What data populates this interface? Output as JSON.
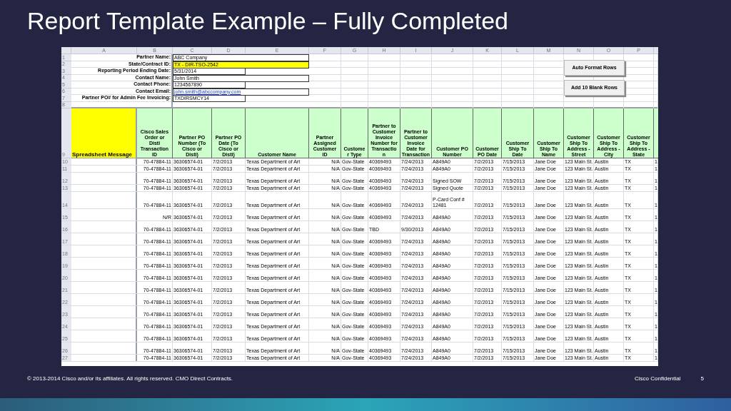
{
  "slide": {
    "title": "Report Template Example – Fully Completed",
    "footer": {
      "copyright": "© 2013-2014  Cisco and/or its affiliates. All rights reserved. CMO Direct Contracts.",
      "classification": "Cisco Confidential",
      "page": "5"
    }
  },
  "sheet": {
    "columns": [
      "A",
      "B",
      "C",
      "D",
      "E",
      "F",
      "G",
      "H",
      "I",
      "J",
      "K",
      "L",
      "M",
      "N",
      "O",
      "P"
    ],
    "info_rows": [
      {
        "number": "1",
        "label": "Partner Name:",
        "value": "ABC Company",
        "kind": "text",
        "highlighted": false
      },
      {
        "number": "2",
        "label": "State/Contract ID:",
        "value": "TX - DIR-TSO-2542",
        "kind": "text",
        "highlighted": true
      },
      {
        "number": "3",
        "label": "Reporting Period Ending Date:",
        "value": "5/31/2014",
        "kind": "text",
        "highlighted": false
      },
      {
        "number": "4",
        "label": "Contact Name:",
        "value": "John Smith",
        "kind": "text",
        "highlighted": false
      },
      {
        "number": "5",
        "label": "Contact Phone:",
        "value": "1234567890",
        "kind": "text",
        "highlighted": false
      },
      {
        "number": "6",
        "label": "Contact Email:",
        "value": "john.smith@abccompany.com",
        "kind": "link",
        "highlighted": false
      },
      {
        "number": "7",
        "label": "Partner PO#  for Admin Fee Invoicing:",
        "value": "TXDIRSMCY14",
        "kind": "text",
        "highlighted": false
      },
      {
        "number": "8"
      }
    ],
    "buttons": [
      "Auto Format Rows",
      "Add 10 Blank Rows"
    ],
    "header": {
      "number": "9",
      "columns": [
        "Spreadsheet Message",
        "Cisco Sales\nOrder or\nDisti\nTransaction\nID",
        "Partner PO\nNumber (To\nCisco or\nDisti)",
        "Partner PO\nDate (To\nCisco or\nDisti)",
        "Customer Name",
        "Partner\nAssigned\nCustomer\nID",
        "Custome\nr Type",
        "Partner to\nCustomer\nInvoice\nNumber for\nTransactio\nn",
        "Partner to\nCustomer\nInvoice\nDate for\nTransaction",
        "Customer PO\nNumber",
        "Customer\nPO Date",
        "Customer\nShip To\nDate",
        "Customer\nShip To\nName",
        "Customer\nShip To\nAddress -\nStreet",
        "Customer\nShip To\nAddress -\nCity",
        "Customer\nShip To\nAddress -\nState"
      ]
    },
    "rows": [
      {
        "number": "10",
        "cells": [
          "",
          "70-47884-11",
          "36306574-01",
          "7/2/2013",
          "Texas Department of Art",
          "N/A",
          "Gov-State",
          "40369493",
          "7/24/2013",
          "A849A0",
          "7/2/2013",
          "7/15/2013",
          "Jane Doe",
          "123 Main St.",
          "Austin",
          "TX",
          "1"
        ]
      },
      {
        "number": "11",
        "cells": [
          "",
          "70-47884-11",
          "36306574-01",
          "7/2/2013",
          "Texas Department of Art",
          "N/A",
          "Gov-State",
          "40369493",
          "7/24/2013",
          "A849A0",
          "7/2/2013",
          "7/15/2013",
          "Jane Doe",
          "123 Main St.",
          "Austin",
          "TX",
          "1"
        ]
      },
      {
        "number": "12",
        "cells": [
          "",
          "70-47884-11",
          "36306574-01",
          "7/2/2013",
          "Texas Department of Art",
          "N/A",
          "Gov-State",
          "40369493",
          "7/24/2013",
          "Signed SOW",
          "7/2/2013",
          "7/15/2013",
          "Jane Doe",
          "123 Main St.",
          "Austin",
          "TX",
          "1"
        ]
      },
      {
        "number": "13",
        "cells": [
          "",
          "70-47884-11",
          "36306574-01",
          "7/2/2013",
          "Texas Department of Art",
          "N/A",
          "Gov-State",
          "40369493",
          "7/24/2013",
          "Signed Quote",
          "7/2/2013",
          "7/15/2013",
          "Jane Doe",
          "123 Main St.",
          "Austin",
          "TX",
          "1"
        ]
      },
      {
        "number": "14",
        "cells": [
          "",
          "70-47884-11",
          "36306574-01",
          "7/2/2013",
          "Texas Department of Art",
          "N/A",
          "Gov-State",
          "40369493",
          "7/24/2013",
          "P-Card Conf #\n12481",
          "7/2/2013",
          "7/15/2013",
          "Jane Doe",
          "123 Main St.",
          "Austin",
          "TX",
          "1"
        ]
      },
      {
        "number": "15",
        "cells": [
          "",
          "N/R",
          "36306574-01",
          "7/2/2013",
          "Texas Department of Art",
          "N/A",
          "Gov-State",
          "40369493",
          "7/24/2013",
          "A849A0",
          "7/2/2013",
          "7/15/2013",
          "Jane Doe",
          "123 Main St.",
          "Austin",
          "TX",
          "1"
        ]
      },
      {
        "number": "16",
        "cells": [
          "",
          "70-47884-11",
          "36306574-01",
          "7/2/2013",
          "Texas Department of Art",
          "N/A",
          "Gov-State",
          "TBD",
          "9/30/2013",
          "A849A0",
          "7/2/2013",
          "7/15/2013",
          "Jane Doe",
          "123 Main St.",
          "Austin",
          "TX",
          "1"
        ]
      },
      {
        "number": "17",
        "cells": [
          "",
          "70-47884-11",
          "36306574-01",
          "7/2/2013",
          "Texas Department of Art",
          "N/A",
          "Gov-State",
          "40369493",
          "7/24/2013",
          "A849A0",
          "7/2/2013",
          "7/15/2013",
          "Jane Doe",
          "123 Main St.",
          "Austin",
          "TX",
          "1"
        ]
      },
      {
        "number": "18",
        "cells": [
          "",
          "70-47884-11",
          "36306574-01",
          "7/2/2013",
          "Texas Department of Art",
          "N/A",
          "Gov-State",
          "40369493",
          "7/24/2013",
          "A849A0",
          "7/2/2013",
          "7/15/2013",
          "Jane Doe",
          "123 Main St.",
          "Austin",
          "TX",
          "1"
        ]
      },
      {
        "number": "19",
        "cells": [
          "",
          "70-47884-11",
          "36306574-01",
          "7/2/2013",
          "Texas Department of Art",
          "N/A",
          "Gov-State",
          "40369493",
          "7/24/2013",
          "A849A0",
          "7/2/2013",
          "7/15/2013",
          "Jane Doe",
          "123 Main St.",
          "Austin",
          "TX",
          "1"
        ]
      },
      {
        "number": "20",
        "cells": [
          "",
          "70-47884-11",
          "36306574-01",
          "7/2/2013",
          "Texas Department of Art",
          "N/A",
          "Gov-State",
          "40369493",
          "7/24/2013",
          "A849A0",
          "7/2/2013",
          "7/15/2013",
          "Jane Doe",
          "123 Main St.",
          "Austin",
          "TX",
          "1"
        ]
      },
      {
        "number": "21",
        "cells": [
          "",
          "70-47884-11",
          "36306574-01",
          "7/2/2013",
          "Texas Department of Art",
          "N/A",
          "Gov-State",
          "40369493",
          "7/24/2013",
          "A849A0",
          "7/2/2013",
          "7/15/2013",
          "Jane Doe",
          "123 Main St.",
          "Austin",
          "TX",
          "1"
        ]
      },
      {
        "number": "22",
        "cells": [
          "",
          "70-47884-11",
          "36306574-01",
          "7/2/2013",
          "Texas Department of Art",
          "N/A",
          "Gov-State",
          "40369493",
          "7/24/2013",
          "A849A0",
          "7/2/2013",
          "7/15/2013",
          "Jane Doe",
          "123 Main St.",
          "Austin",
          "TX",
          "1"
        ]
      },
      {
        "number": "23",
        "cells": [
          "",
          "70-47884-11",
          "36306574-01",
          "7/2/2013",
          "Texas Department of Art",
          "N/A",
          "Gov-State",
          "40369493",
          "7/24/2013",
          "A849A0",
          "7/2/2013",
          "7/15/2013",
          "Jane Doe",
          "123 Main St.",
          "Austin",
          "TX",
          "1"
        ]
      },
      {
        "number": "24",
        "cells": [
          "",
          "70-47884-11",
          "36306574-01",
          "7/2/2013",
          "Texas Department of Art",
          "N/A",
          "Gov-State",
          "40369493",
          "7/24/2013",
          "A849A0",
          "7/2/2013",
          "7/15/2013",
          "Jane Doe",
          "123 Main St.",
          "Austin",
          "TX",
          "1"
        ]
      },
      {
        "number": "25",
        "cells": [
          "",
          "70-47884-11",
          "36306574-01",
          "7/2/2013",
          "Texas Department of Art",
          "N/A",
          "Gov-State",
          "40369493",
          "7/24/2013",
          "A849A0",
          "7/2/2013",
          "7/15/2013",
          "Jane Doe",
          "123 Main St.",
          "Austin",
          "TX",
          "1"
        ]
      },
      {
        "number": "26",
        "cells": [
          "",
          "70-47884-11",
          "36306574-01",
          "7/2/2013",
          "Texas Department of Art",
          "N/A",
          "Gov-State",
          "40369493",
          "7/24/2013",
          "A849A0",
          "7/2/2013",
          "7/15/2013",
          "Jane Doe",
          "123 Main St.",
          "Austin",
          "TX",
          "1"
        ]
      },
      {
        "number": "27",
        "cells": [
          "",
          "70-47884-11",
          "36306574-01",
          "7/2/2013",
          "Texas Department of Art",
          "N/A",
          "Gov-State",
          "40369493",
          "7/24/2013",
          "A849A0",
          "7/2/2013",
          "7/15/2013",
          "Jane Doe",
          "123 Main St.",
          "Austin",
          "TX",
          "1"
        ]
      }
    ]
  }
}
